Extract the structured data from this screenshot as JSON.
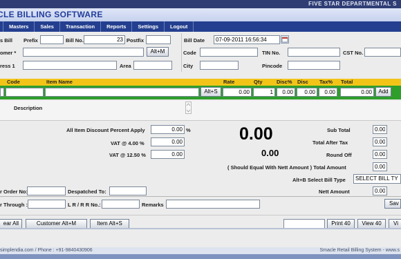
{
  "header": {
    "company": "FIVE STAR DEPARTMENTAL S",
    "app_title": "CLE BILLING SOFTWARE"
  },
  "menu": [
    "Masters",
    "Sales",
    "Transaction",
    "Reports",
    "Settings",
    "Logout"
  ],
  "bill": {
    "type_label": "s Bill",
    "prefix_label": "Prefix",
    "prefix_value": "",
    "billno_label": "Bill No.",
    "billno_value": "23",
    "postfix_label": "Postfix",
    "postfix_value": "",
    "billdate_label": "Bill Date",
    "billdate_value": "07-09-2011 16:56:34"
  },
  "customer": {
    "customer_label": "omer *",
    "customer_value": "",
    "altm_button": "Alt+M",
    "code_label": "Code",
    "code_value": "",
    "tin_label": "TIN No.",
    "tin_value": "",
    "cst_label": "CST No.",
    "cst_value": "",
    "address_label": "ress 1",
    "address_value": "",
    "area_label": "Area",
    "area_value": "",
    "city_label": "City",
    "city_value": "",
    "pincode_label": "Pincode",
    "pincode_value": ""
  },
  "grid": {
    "headers": {
      "code": "Code",
      "item_name": "Item Name",
      "rate": "Rate",
      "qty": "Qty",
      "disc_pct": "Disc%",
      "disc": "Disc",
      "tax_pct": "Tax%",
      "total": "Total"
    },
    "row": {
      "alts_button": "Alt+S",
      "rate": "0.00",
      "qty": "1",
      "disc_pct": "0.00",
      "disc": "0.00",
      "tax_pct": "0.00",
      "total": "0.00",
      "add_button": "Add"
    },
    "description_label": "Description"
  },
  "summary": {
    "all_discount_label": "All Item Discount Percent Apply",
    "all_discount_value": "0.00",
    "percent_sign": "%",
    "vat4_label": "VAT @ 4.00 %",
    "vat4_value": "0.00",
    "vat125_label": "VAT @ 12.50 %",
    "vat125_value": "0.00",
    "grand_total": "0.00",
    "secondary_total": "0.00",
    "subtotal_label": "Sub Total",
    "subtotal_value": "0.00",
    "after_tax_label": "Total After Tax",
    "after_tax_value": "0.00",
    "roundoff_label": "Round Off",
    "roundoff_value": "0.00",
    "total_amount_label": "( Should Equal With Nett Amount ) Total Amount",
    "total_amount_value": "0.00",
    "billtype_label": "Alt+B   Select Bill Type",
    "billtype_value": "SELECT BILL TY",
    "nett_label": "Nett Amount",
    "nett_value": "0.00"
  },
  "dispatch": {
    "order_label": "r Order No:",
    "order_value": "",
    "despatched_label": "Despatched To:",
    "despatched_value": "",
    "through_label": "r Through :",
    "through_value": "",
    "lr_label": "L R / R R No.:",
    "lr_value": "",
    "remarks_label": "Remarks",
    "remarks_value": "",
    "save_button": "Sav"
  },
  "bottom_buttons": {
    "clear": "ear All",
    "customer": "Customer Alt+M",
    "item": "Item Alt+S",
    "print": "Print 40",
    "view": "View 40",
    "vi": "Vi"
  },
  "footer": {
    "left": "simplendia.com / Phone : +91-9840430906",
    "right": "Smacle Retail Billing System - www.s"
  }
}
